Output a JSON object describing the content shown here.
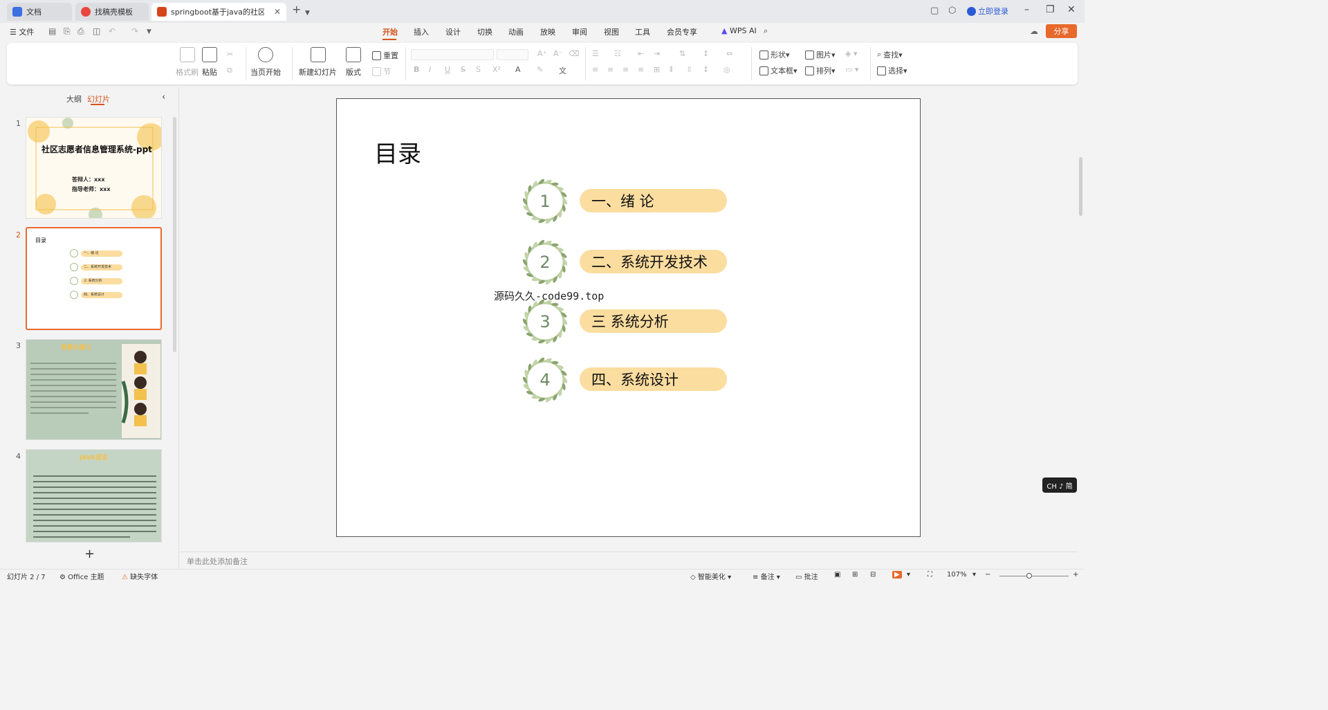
{
  "tabs": [
    {
      "label": "文档",
      "icon": "doc-icon",
      "color": "#3c6fe0"
    },
    {
      "label": "找稿壳模板",
      "icon": "template-icon",
      "color": "#e8463c"
    },
    {
      "label": "springboot基于java的社区志愿者信息管理系统",
      "icon": "ppt-icon",
      "color": "#d4451c"
    }
  ],
  "titlebar": {
    "login": "立即登录",
    "new_tab": "+"
  },
  "menubar": {
    "file": "文件",
    "items": [
      "开始",
      "插入",
      "设计",
      "切换",
      "动画",
      "放映",
      "审阅",
      "视图",
      "工具",
      "会员专享"
    ],
    "active": "开始",
    "wps_ai": "WPS AI",
    "share": "分享"
  },
  "ribbon": {
    "format_painter": "格式刷",
    "paste": "粘贴",
    "start_from_current": "当页开始",
    "new_slide": "新建幻灯片",
    "layout": "版式",
    "reset": "重置",
    "section": "节",
    "shape": "形状",
    "picture": "图片",
    "textbox": "文本框",
    "arrange": "排列",
    "find": "查找",
    "select": "选择"
  },
  "leftpanel": {
    "tab_outline": "大纲",
    "tab_slides": "幻灯片",
    "slides": [
      {
        "num": "1",
        "title": "社区志愿者信息管理系统-ppt",
        "defender": "答辩人：xxx",
        "advisor": "指导老师：xxx"
      },
      {
        "num": "2",
        "title": "目录",
        "items": [
          "一、绪 论",
          "二、系统开发技术",
          "三 系统分析",
          "四、系统设计"
        ]
      },
      {
        "num": "3",
        "title": "背景与意义"
      },
      {
        "num": "4",
        "title": "JAVA语言"
      }
    ]
  },
  "slide": {
    "title": "目录",
    "toc": [
      {
        "num": "1",
        "label": "一、绪  论"
      },
      {
        "num": "2",
        "label": "二、系统开发技术"
      },
      {
        "num": "3",
        "label": "三    系统分析"
      },
      {
        "num": "4",
        "label": "四、系统设计"
      }
    ],
    "watermark": "源码久久-code99.top"
  },
  "notes_placeholder": "单击此处添加备注",
  "ime": "CH ♪ 简",
  "statusbar": {
    "slide_index": "幻灯片 2 / 7",
    "theme": "Office 主题",
    "missing_font": "缺失字体",
    "smart_beautify": "智能美化",
    "notes": "备注",
    "comments": "批注",
    "zoom": "107%",
    "zoom_level": 0.43
  },
  "colors": {
    "accent": "#d4561a",
    "pill": "#fbdda0",
    "wreath": "#8aa46e"
  }
}
